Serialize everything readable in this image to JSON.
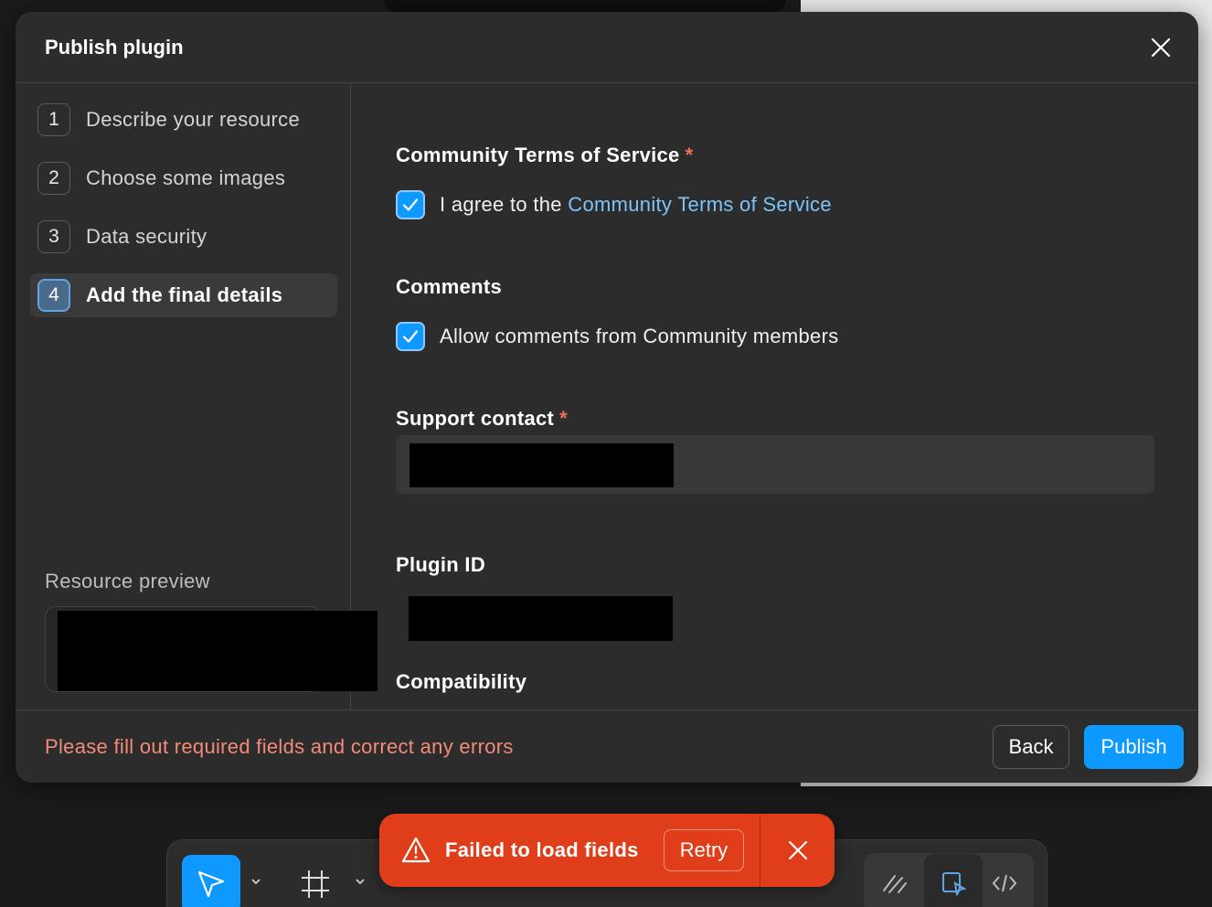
{
  "modal": {
    "title": "Publish plugin",
    "steps": [
      {
        "num": "1",
        "label": "Describe your resource"
      },
      {
        "num": "2",
        "label": "Choose some images"
      },
      {
        "num": "3",
        "label": "Data security"
      },
      {
        "num": "4",
        "label": "Add the final details"
      }
    ],
    "active_step": 4,
    "resource_preview_label": "Resource preview"
  },
  "form": {
    "terms": {
      "title": "Community Terms of Service",
      "required_mark": "*",
      "checkbox_prefix": "I agree to the",
      "checkbox_link": "Community Terms of Service",
      "checked": true
    },
    "comments": {
      "title": "Comments",
      "checkbox_label": "Allow comments from Community members",
      "checked": true
    },
    "support": {
      "title": "Support contact",
      "required_mark": "*"
    },
    "plugin_id": {
      "title": "Plugin ID"
    },
    "compatibility": {
      "title": "Compatibility"
    }
  },
  "footer": {
    "error": "Please fill out required fields and correct any errors",
    "back_label": "Back",
    "publish_label": "Publish"
  },
  "toast": {
    "message": "Failed to load fields",
    "retry_label": "Retry"
  },
  "colors": {
    "accent": "#0d99ff",
    "error_text": "#f28b7a",
    "toast_bg": "#e03e1a",
    "link": "#7cc4fa"
  },
  "icons": [
    "close-icon",
    "checkmark-icon",
    "warning-icon",
    "move-tool-icon",
    "frame-tool-icon",
    "chevron-down-icon",
    "draw-icon",
    "dev-mode-icon",
    "code-icon"
  ]
}
